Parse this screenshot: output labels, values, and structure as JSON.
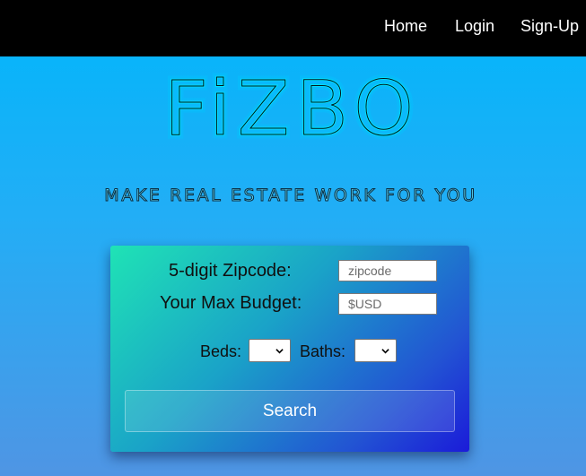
{
  "nav": {
    "items": [
      {
        "label": "Home"
      },
      {
        "label": "Login"
      },
      {
        "label": "Sign-Up"
      }
    ]
  },
  "brand": {
    "logo_text": "FiZBO",
    "tagline": "MAKE REAL ESTATE WORK FOR YOU"
  },
  "search_form": {
    "zipcode_label": "5-digit Zipcode:",
    "zipcode_placeholder": "zipcode",
    "zipcode_value": "",
    "budget_label": "Your Max Budget:",
    "budget_placeholder": "$USD",
    "budget_value": "",
    "beds_label": "Beds:",
    "beds_selected": "",
    "baths_label": "Baths:",
    "baths_selected": "",
    "submit_label": "Search"
  },
  "colors": {
    "topbar": "#000000",
    "page_gradient_top": "#00b6fb",
    "page_gradient_bottom": "#4f95e4",
    "logo_neon": "#00e8ff",
    "card_gradient_start": "#1fe3b5",
    "card_gradient_end": "#1b1bd9"
  }
}
